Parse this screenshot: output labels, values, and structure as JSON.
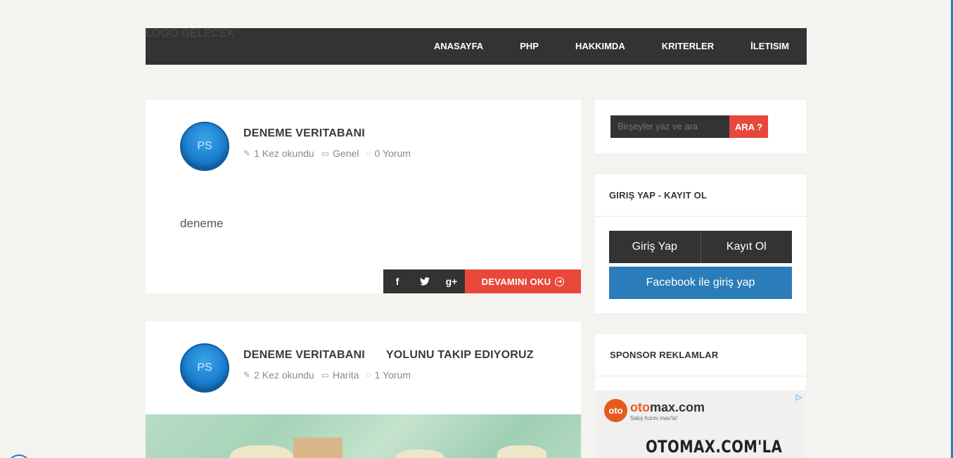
{
  "header": {
    "logo_text": "LOGO GELECEK",
    "nav": [
      "ANASAYFA",
      "PHP",
      "HAKKIMDA",
      "KRITERLER",
      "İLETISIM"
    ]
  },
  "posts": [
    {
      "avatar": "PS",
      "title": "DENEME VERITABANI",
      "reads": "1 Kez okundu",
      "category": "Genel",
      "comments": "0 Yorum",
      "excerpt": "deneme",
      "read_more": "DEVAMINI OKU"
    },
    {
      "avatar": "PS",
      "title_part1": "DENEME VERITABANI",
      "title_part2": "YOLUNU TAKIP EDIYORUZ",
      "reads": "2 Kez okundu",
      "category": "Harita",
      "comments": "1 Yorum"
    }
  ],
  "share": {
    "facebook": "f",
    "twitter": "t",
    "googleplus": "g+"
  },
  "sidebar": {
    "search_placeholder": "Birşeyler yaz ve ara",
    "search_button": "ARA ?",
    "login_title": "GIRIŞ YAP - KAYIT OL",
    "login_button": "Giriş Yap",
    "register_button": "Kayıt Ol",
    "facebook_button": "Facebook ile giriş yap",
    "sponsor_title": "SPONSOR REKLAMLAR",
    "ad": {
      "logo_mark": "oto",
      "brand_prefix": "oto",
      "brand_suffix": "max.com",
      "tagline": "Satış hızını max'la!",
      "headline": "OTOMAX.COM'LA"
    }
  },
  "colors": {
    "accent": "#e8483b",
    "dark": "#333333",
    "facebook": "#2b7cba",
    "background": "#f4f3ef"
  }
}
